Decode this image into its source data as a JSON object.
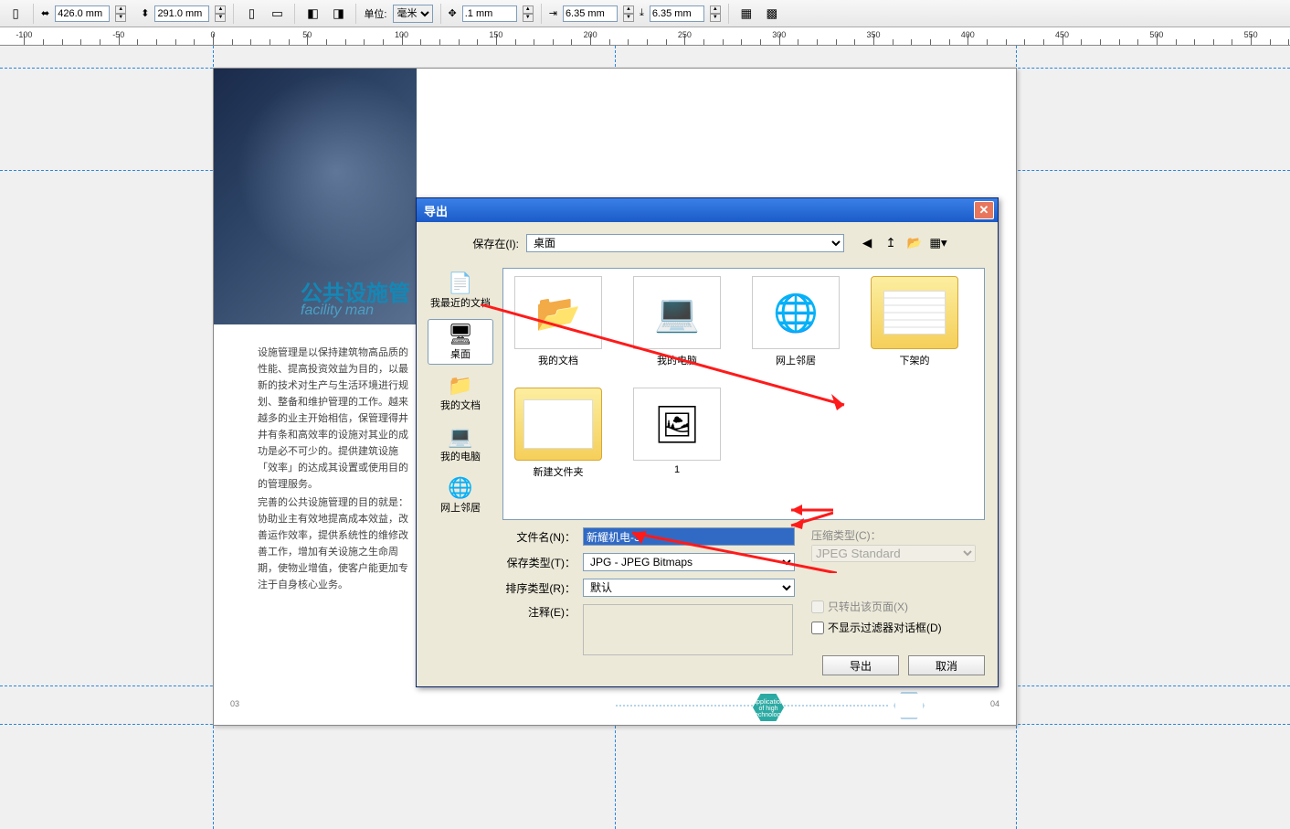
{
  "propbar": {
    "page_w": "426.0 mm",
    "page_h": "291.0 mm",
    "unit_label": "单位:",
    "unit_value": "毫米",
    "nudge": ".1 mm",
    "dup_x": "6.35 mm",
    "dup_y": "6.35 mm"
  },
  "ruler": {
    "marks": [
      -100,
      -50,
      0,
      50,
      100,
      150,
      200,
      250,
      300,
      350,
      400,
      450,
      500,
      550
    ]
  },
  "document": {
    "title_cn": "公共设施管",
    "title_en": "facility man",
    "para1": "设施管理是以保持建筑物高品质的性能、提高投资效益为目的，以最新的技术对生产与生活环境进行规划、整备和维护管理的工作。越来越多的业主开始相信，保管理得井井有条和高效率的设施对其业的成功是必不可少的。提供建筑设施「效率」的达成其设置或使用目的的管理服务。",
    "para2": "完善的公共设施管理的目的就是：协助业主有效地提高成本效益，改善运作效率，提供系统性的维修改善工作，增加有关设施之生命周期，使物业增值，使客户能更加专注于自身核心业务。",
    "page_l": "03",
    "page_r": "04",
    "hex_text": "application of high technology"
  },
  "dialog": {
    "title": "导出",
    "save_in_label": "保存在(I):",
    "save_in_value": "桌面",
    "places": [
      {
        "label": "我最近的文档",
        "icon": "📄"
      },
      {
        "label": "桌面",
        "icon": "🖥",
        "selected": true
      },
      {
        "label": "我的文档",
        "icon": "📁"
      },
      {
        "label": "我的电脑",
        "icon": "💻"
      },
      {
        "label": "网上邻居",
        "icon": "🌐"
      }
    ],
    "files": [
      {
        "label": "我的文档",
        "kind": "docs"
      },
      {
        "label": "我的电脑",
        "kind": "computer"
      },
      {
        "label": "网上邻居",
        "kind": "network"
      },
      {
        "label": "下架的",
        "kind": "folder-lines"
      },
      {
        "label": "新建文件夹",
        "kind": "folder-thumbs"
      },
      {
        "label": "1",
        "kind": "image"
      }
    ],
    "filename_label": "文件名(N)：",
    "filename_value": "新耀机电-3",
    "savetype_label": "保存类型(T)：",
    "savetype_value": "JPG - JPEG Bitmaps",
    "sorttype_label": "排序类型(R)：",
    "sorttype_value": "默认",
    "notes_label": "注释(E)：",
    "compress_label": "压缩类型(C)：",
    "compress_value": "JPEG Standard",
    "only_page_label": "只转出该页面(X)",
    "no_filter_label": "不显示过滤器对话框(D)",
    "btn_export": "导出",
    "btn_cancel": "取消"
  }
}
